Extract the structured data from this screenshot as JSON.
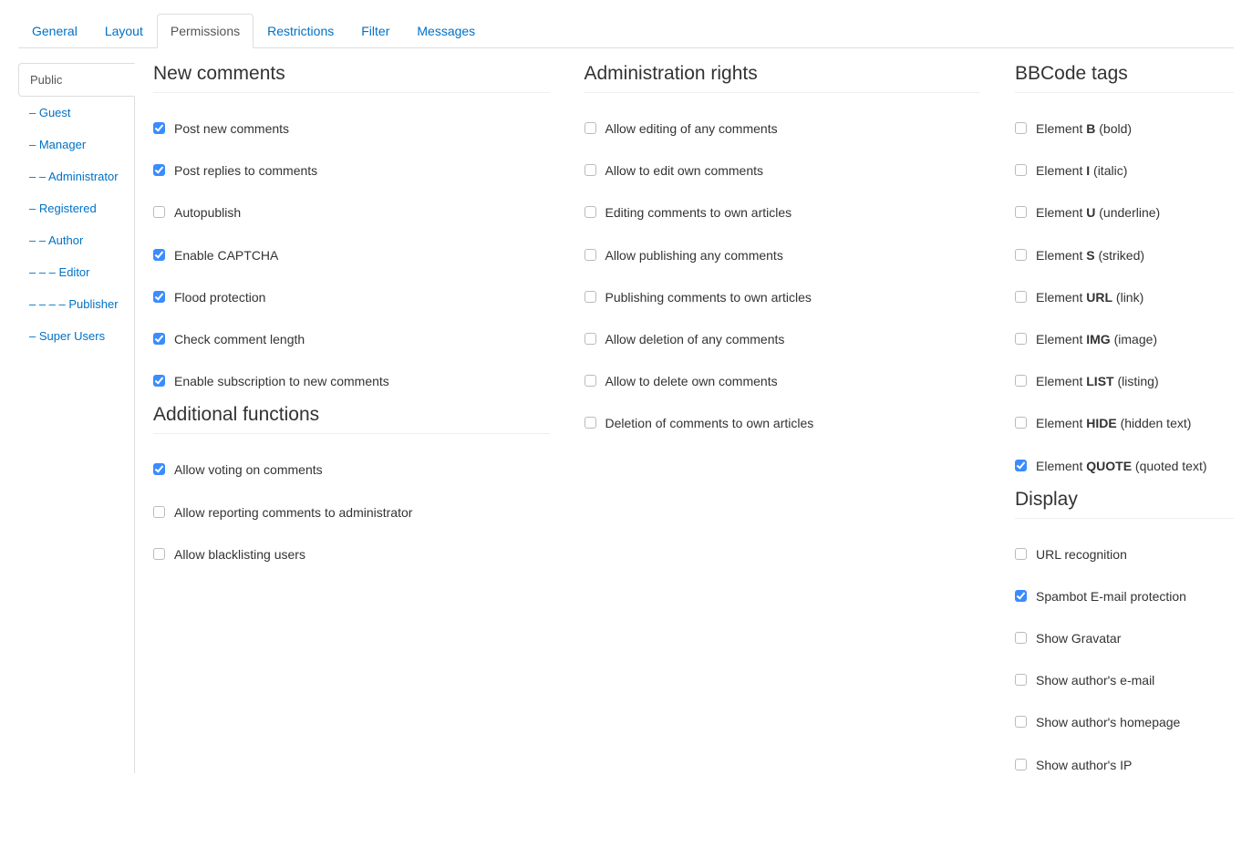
{
  "tabs": [
    {
      "label": "General",
      "active": false
    },
    {
      "label": "Layout",
      "active": false
    },
    {
      "label": "Permissions",
      "active": true
    },
    {
      "label": "Restrictions",
      "active": false
    },
    {
      "label": "Filter",
      "active": false
    },
    {
      "label": "Messages",
      "active": false
    }
  ],
  "sidebar": [
    {
      "label": "Public",
      "active": true
    },
    {
      "label": "– Guest",
      "active": false
    },
    {
      "label": "– Manager",
      "active": false
    },
    {
      "label": "– – Administrator",
      "active": false
    },
    {
      "label": "– Registered",
      "active": false
    },
    {
      "label": "– – Author",
      "active": false
    },
    {
      "label": "– – – Editor",
      "active": false
    },
    {
      "label": "– – – – Publisher",
      "active": false
    },
    {
      "label": "– Super Users",
      "active": false
    }
  ],
  "sections": {
    "new_comments": {
      "title": "New comments",
      "items": [
        {
          "label": "Post new comments",
          "checked": true
        },
        {
          "label": "Post replies to comments",
          "checked": true
        },
        {
          "label": "Autopublish",
          "checked": false
        },
        {
          "label": "Enable CAPTCHA",
          "checked": true
        },
        {
          "label": "Flood protection",
          "checked": true
        },
        {
          "label": "Check comment length",
          "checked": true
        },
        {
          "label": "Enable subscription to new comments",
          "checked": true
        }
      ]
    },
    "additional": {
      "title": "Additional functions",
      "items": [
        {
          "label": "Allow voting on comments",
          "checked": true
        },
        {
          "label": "Allow reporting comments to administrator",
          "checked": false
        },
        {
          "label": "Allow blacklisting users",
          "checked": false
        }
      ]
    },
    "admin": {
      "title": "Administration rights",
      "items": [
        {
          "label": "Allow editing of any comments",
          "checked": false
        },
        {
          "label": "Allow to edit own comments",
          "checked": false
        },
        {
          "label": "Editing comments to own articles",
          "checked": false
        },
        {
          "label": "Allow publishing any comments",
          "checked": false
        },
        {
          "label": "Publishing comments to own articles",
          "checked": false
        },
        {
          "label": "Allow deletion of any comments",
          "checked": false
        },
        {
          "label": "Allow to delete own comments",
          "checked": false
        },
        {
          "label": "Deletion of comments to own articles",
          "checked": false
        }
      ]
    },
    "bbcode": {
      "title": "BBCode tags",
      "items": [
        {
          "prefix": "Element ",
          "bold": "B",
          "suffix": " (bold)",
          "checked": false
        },
        {
          "prefix": "Element ",
          "bold": "I",
          "suffix": " (italic)",
          "checked": false
        },
        {
          "prefix": "Element ",
          "bold": "U",
          "suffix": " (underline)",
          "checked": false
        },
        {
          "prefix": "Element ",
          "bold": "S",
          "suffix": " (striked)",
          "checked": false
        },
        {
          "prefix": "Element ",
          "bold": "URL",
          "suffix": " (link)",
          "checked": false
        },
        {
          "prefix": "Element ",
          "bold": "IMG",
          "suffix": " (image)",
          "checked": false
        },
        {
          "prefix": "Element ",
          "bold": "LIST",
          "suffix": " (listing)",
          "checked": false
        },
        {
          "prefix": "Element ",
          "bold": "HIDE",
          "suffix": " (hidden text)",
          "checked": false
        },
        {
          "prefix": "Element ",
          "bold": "QUOTE",
          "suffix": " (quoted text)",
          "checked": true
        }
      ]
    },
    "display": {
      "title": "Display",
      "items": [
        {
          "label": "URL recognition",
          "checked": false
        },
        {
          "label": "Spambot E-mail protection",
          "checked": true
        },
        {
          "label": "Show Gravatar",
          "checked": false
        },
        {
          "label": "Show author's e-mail",
          "checked": false
        },
        {
          "label": "Show author's homepage",
          "checked": false
        },
        {
          "label": "Show author's IP",
          "checked": false
        }
      ]
    }
  }
}
